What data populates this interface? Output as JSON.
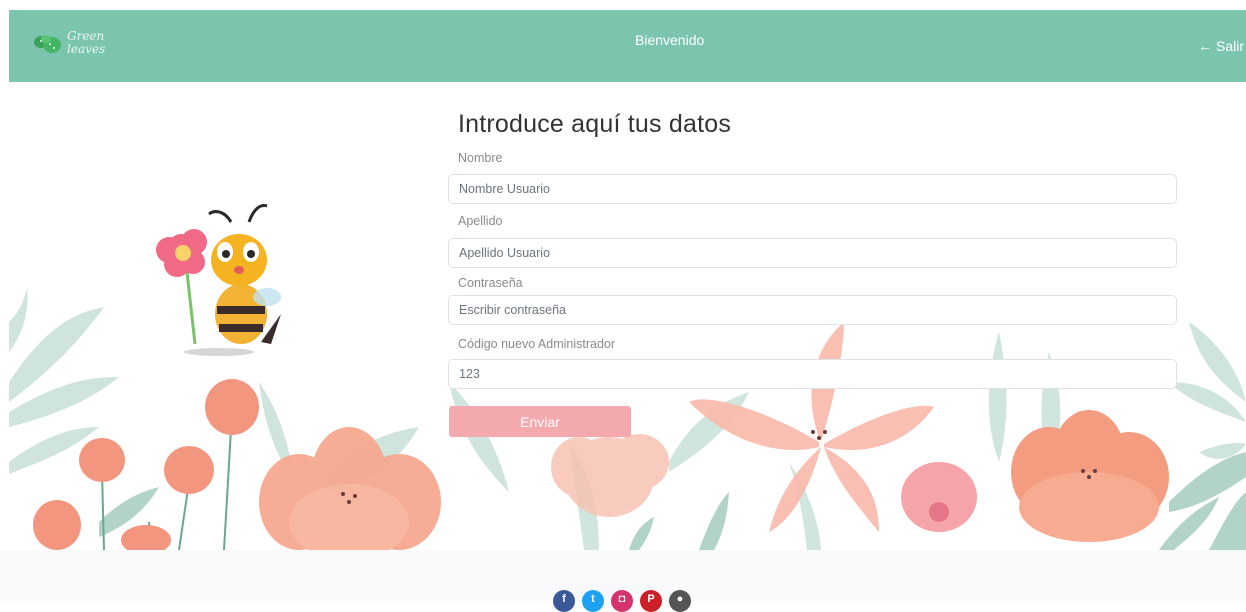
{
  "header": {
    "logo_text": "Green\nleaves",
    "title": "Bienvenido",
    "logout_label": "← Salir"
  },
  "form": {
    "title": "Introduce aquí tus datos",
    "fields": [
      {
        "label": "Nombre",
        "placeholder": "Nombre Usuario",
        "value": ""
      },
      {
        "label": "Apellido",
        "placeholder": "Apellido Usuario",
        "value": ""
      },
      {
        "label": "Contraseña",
        "placeholder": "Escribir contraseña",
        "value": ""
      },
      {
        "label": "Código nuevo Administrador",
        "placeholder": "",
        "value": "123"
      }
    ],
    "submit_label": "Enviar"
  },
  "footer": {
    "social": [
      {
        "icon": "facebook-icon",
        "glyph": "f",
        "color": "#3b5998"
      },
      {
        "icon": "twitter-icon",
        "glyph": "t",
        "color": "#1da1f2"
      },
      {
        "icon": "instagram-icon",
        "glyph": "◘",
        "color": "#d6336c"
      },
      {
        "icon": "pinterest-icon",
        "glyph": "P",
        "color": "#cb2027"
      },
      {
        "icon": "github-icon",
        "glyph": "●",
        "color": "#555555"
      }
    ]
  },
  "colors": {
    "header": "#7bc4ae",
    "button": "#f4a9ae"
  }
}
